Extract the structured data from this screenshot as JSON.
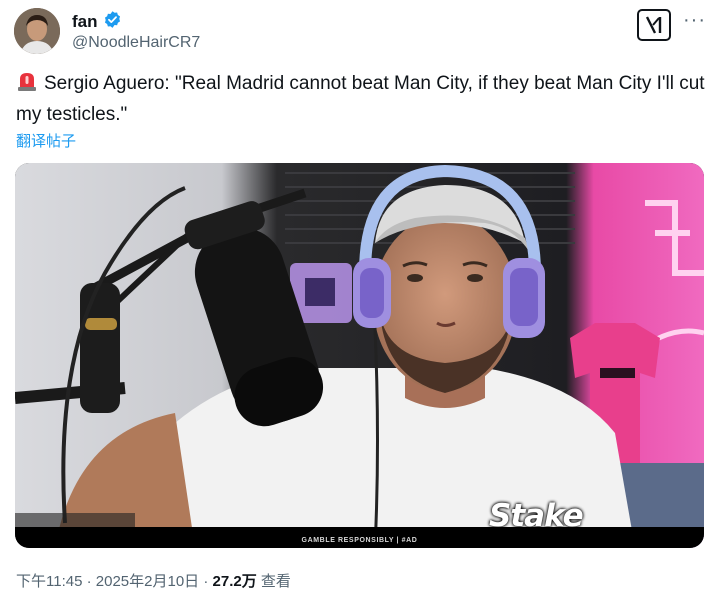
{
  "author": {
    "display_name": "fan",
    "handle": "@NoodleHairCR7",
    "verified": true
  },
  "header": {
    "grok_icon": "grok-icon",
    "more_icon": "more-icon"
  },
  "tweet": {
    "emoji": "police-siren-icon",
    "text": "Sergio Aguero: \"Real Madrid cannot beat Man City, if they beat Man City I'll cut my testicles.\"",
    "translate_label": "翻译帖子"
  },
  "media": {
    "disclaimer": "GAMBLE RESPONSIBLY  |  #AD",
    "logo": "Stake"
  },
  "meta": {
    "time": "下午11:45",
    "date": "2025年2月10日",
    "views": "27.2万",
    "views_label": "查看",
    "separator": "·"
  },
  "colors": {
    "link": "#1d9bf0",
    "verified": "#1d9bf0",
    "muted": "#536471",
    "neon_pink": "#ff2fb8"
  }
}
